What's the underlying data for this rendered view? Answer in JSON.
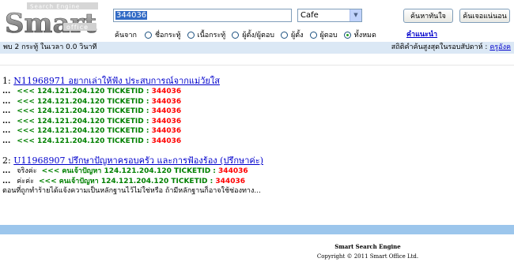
{
  "logo": {
    "big_text": "Smart",
    "top_text": "Search Engine",
    "sub_text": "office"
  },
  "search": {
    "query": "344036",
    "category": "Cafe",
    "search_button": "ค้นหาทันใจ",
    "lucky_button": "ค้นเจอแน่นอน",
    "advice_link": "คำแนะนำ"
  },
  "search_in": {
    "label": "ค้นจาก",
    "options": [
      {
        "label": "ชื่อกระทู้",
        "checked": false
      },
      {
        "label": "เนื้อกระทู้",
        "checked": false
      },
      {
        "label": "ผู้ตั้ง/ผู้ตอบ",
        "checked": false
      },
      {
        "label": "ผู้ตั้ง",
        "checked": false
      },
      {
        "label": "ผู้ตอบ",
        "checked": false
      },
      {
        "label": "ทั้งหมด",
        "checked": true
      }
    ]
  },
  "status": {
    "summary": "พบ 2 กระทู้ ในเวลา 0.0 วินาที",
    "stats_label": "สถิติคำค้นสูงสุดในรอบสัปดาห์ :",
    "stats_link": "ครูอังค"
  },
  "results": [
    {
      "index": "1:",
      "title": "N11968971 อยากเล่าให้ฟัง ประสบการณ์จากแม่วัยใส",
      "lines": [
        {
          "dots": "...",
          "prefix": "",
          "green": "<<< 124.121.204.120 TICKETID :",
          "red": "344036"
        },
        {
          "dots": "...",
          "prefix": "",
          "green": "<<< 124.121.204.120 TICKETID :",
          "red": "344036"
        },
        {
          "dots": "...",
          "prefix": "",
          "green": "<<< 124.121.204.120 TICKETID :",
          "red": "344036"
        },
        {
          "dots": "...",
          "prefix": "",
          "green": "<<< 124.121.204.120 TICKETID :",
          "red": "344036"
        },
        {
          "dots": "...",
          "prefix": "",
          "green": "<<< 124.121.204.120 TICKETID :",
          "red": "344036"
        },
        {
          "dots": "...",
          "prefix": "",
          "green": "<<< 124.121.204.120 TICKETID :",
          "red": "344036"
        }
      ]
    },
    {
      "index": "2:",
      "title": "U11968907 ปรึกษาปัญหาครอบครัว และการฟ้องร้อง (ปรึกษาค่ะ)",
      "lines": [
        {
          "dots": "...",
          "prefix": "จริงค่ะ",
          "green": "<<< คนเจ้าปัญหา 124.121.204.120 TICKETID :",
          "red": "344036"
        },
        {
          "dots": "...",
          "prefix": "ค่ะค่ะ",
          "green": "<<< คนเจ้าปัญหา 124.121.204.120 TICKETID :",
          "red": "344036"
        }
      ],
      "snippet": "ตอนที่ถูกทำร้ายได้แจ้งความเป็นหลักฐานไว้ไม่ใช่หรือ ถ้ามีหลักฐานก็อาจใช้ช่องทาง..."
    }
  ],
  "footer": {
    "title": "Smart Search Engine",
    "copyright": "Copyright © 2011 Smart Office Ltd."
  },
  "colors": {
    "status_bar": "#dbe8f5",
    "footer_bar": "#9cc6ec",
    "link": "#0000cc",
    "green": "#008000",
    "red": "#ff0000"
  }
}
